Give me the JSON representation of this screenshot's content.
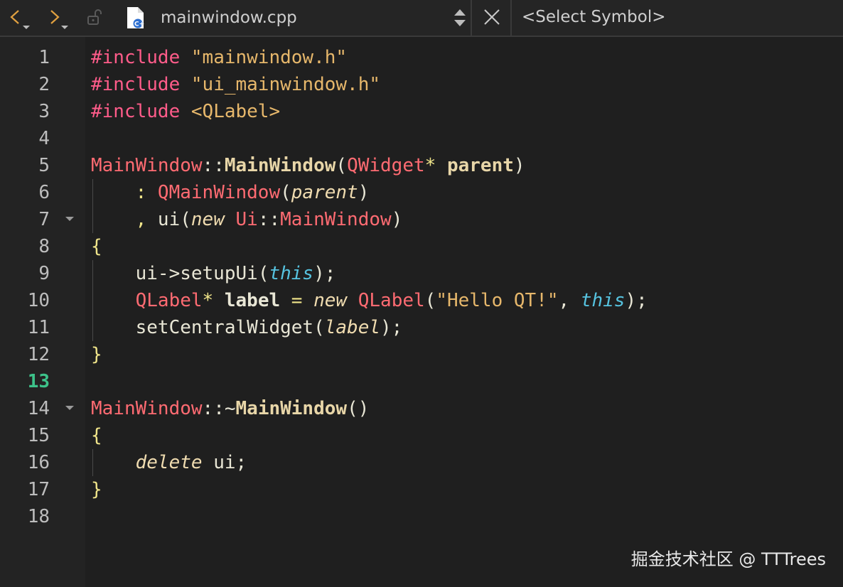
{
  "toolbar": {
    "file_name": "mainwindow.cpp",
    "symbol_placeholder": "<Select Symbol>",
    "back_icon": "chevron-left-icon",
    "forward_icon": "chevron-right-icon",
    "lock_icon": "unlock-icon",
    "file_type_icon": "cpp-file-icon",
    "switch_icon": "up-down-arrows-icon",
    "close_icon": "close-icon"
  },
  "editor": {
    "current_line": 13,
    "line_numbers": [
      "1",
      "2",
      "3",
      "4",
      "5",
      "6",
      "7",
      "8",
      "9",
      "10",
      "11",
      "12",
      "13",
      "14",
      "15",
      "16",
      "17",
      "18"
    ],
    "lines": [
      [
        {
          "t": "#include ",
          "c": "pp"
        },
        {
          "t": "\"mainwindow.h\"",
          "c": "str"
        }
      ],
      [
        {
          "t": "#include ",
          "c": "pp"
        },
        {
          "t": "\"ui_mainwindow.h\"",
          "c": "str"
        }
      ],
      [
        {
          "t": "#include ",
          "c": "pp"
        },
        {
          "t": "<QLabel>",
          "c": "str"
        }
      ],
      [],
      [
        {
          "t": "MainWindow",
          "c": "typ"
        },
        {
          "t": "::",
          "c": "punc"
        },
        {
          "t": "MainWindow",
          "c": "fn"
        },
        {
          "t": "(",
          "c": "punc"
        },
        {
          "t": "QWidget",
          "c": "typ"
        },
        {
          "t": "* ",
          "c": "op"
        },
        {
          "t": "parent",
          "c": "fn"
        },
        {
          "t": ")",
          "c": "punc"
        }
      ],
      [
        {
          "t": "    : ",
          "c": "op"
        },
        {
          "t": "QMainWindow",
          "c": "typ"
        },
        {
          "t": "(",
          "c": "punc"
        },
        {
          "t": "parent",
          "c": "par"
        },
        {
          "t": ")",
          "c": "punc"
        }
      ],
      [
        {
          "t": "    , ",
          "c": "op"
        },
        {
          "t": "ui",
          "c": "var"
        },
        {
          "t": "(",
          "c": "punc"
        },
        {
          "t": "new ",
          "c": "kw"
        },
        {
          "t": "Ui",
          "c": "typ"
        },
        {
          "t": "::",
          "c": "punc"
        },
        {
          "t": "MainWindow",
          "c": "typ"
        },
        {
          "t": ")",
          "c": "punc"
        }
      ],
      [
        {
          "t": "{",
          "c": "op"
        }
      ],
      [
        {
          "t": "    ui->setupUi",
          "c": "call"
        },
        {
          "t": "(",
          "c": "punc"
        },
        {
          "t": "this",
          "c": "this"
        },
        {
          "t": ");",
          "c": "punc"
        }
      ],
      [
        {
          "t": "    ",
          "c": "var"
        },
        {
          "t": "QLabel",
          "c": "typ"
        },
        {
          "t": "* ",
          "c": "op"
        },
        {
          "t": "label",
          "c": "bold"
        },
        {
          "t": " = ",
          "c": "op"
        },
        {
          "t": "new ",
          "c": "kw"
        },
        {
          "t": "QLabel",
          "c": "typ"
        },
        {
          "t": "(",
          "c": "punc"
        },
        {
          "t": "\"Hello QT!\"",
          "c": "str"
        },
        {
          "t": ", ",
          "c": "punc"
        },
        {
          "t": "this",
          "c": "this"
        },
        {
          "t": ");",
          "c": "punc"
        }
      ],
      [
        {
          "t": "    setCentralWidget",
          "c": "call"
        },
        {
          "t": "(",
          "c": "punc"
        },
        {
          "t": "label",
          "c": "par"
        },
        {
          "t": ");",
          "c": "punc"
        }
      ],
      [
        {
          "t": "}",
          "c": "op"
        }
      ],
      [],
      [
        {
          "t": "MainWindow",
          "c": "typ"
        },
        {
          "t": "::~",
          "c": "punc"
        },
        {
          "t": "MainWindow",
          "c": "fn"
        },
        {
          "t": "()",
          "c": "punc"
        }
      ],
      [
        {
          "t": "{",
          "c": "op"
        }
      ],
      [
        {
          "t": "    ",
          "c": "var"
        },
        {
          "t": "delete",
          "c": "kw"
        },
        {
          "t": " ui;",
          "c": "var"
        }
      ],
      [
        {
          "t": "}",
          "c": "op"
        }
      ],
      []
    ]
  },
  "watermark": "掘金技术社区 @ TTTrees"
}
